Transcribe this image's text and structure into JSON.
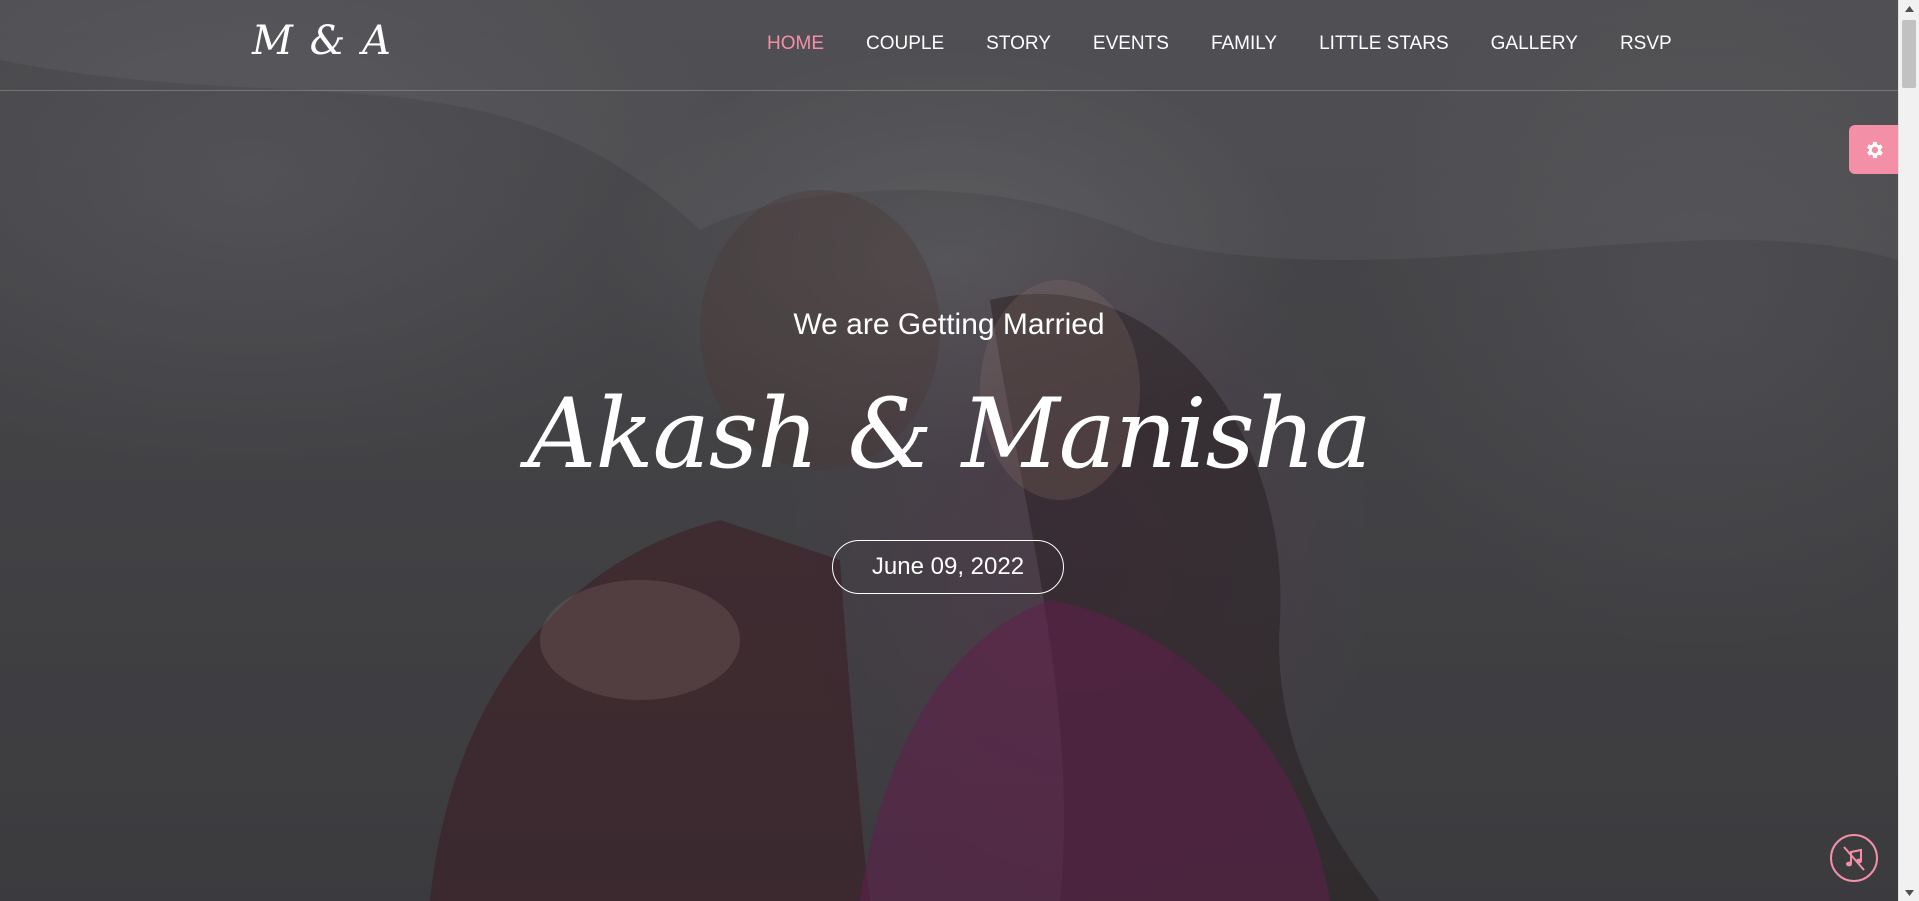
{
  "header": {
    "logo": "M & A",
    "nav": [
      {
        "label": "HOME",
        "active": true
      },
      {
        "label": "COUPLE",
        "active": false
      },
      {
        "label": "STORY",
        "active": false
      },
      {
        "label": "EVENTS",
        "active": false
      },
      {
        "label": "FAMILY",
        "active": false
      },
      {
        "label": "LITTLE STARS",
        "active": false
      },
      {
        "label": "GALLERY",
        "active": false
      },
      {
        "label": "RSVP",
        "active": false
      }
    ]
  },
  "hero": {
    "subtitle": "We are Getting Married",
    "names": "Akash & Manisha",
    "date": "June 09, 2022"
  },
  "widgets": {
    "settings_icon": "gear-icon",
    "music_icon": "music-muted-icon"
  },
  "colors": {
    "accent": "#f48fa8",
    "text": "#ffffff"
  }
}
